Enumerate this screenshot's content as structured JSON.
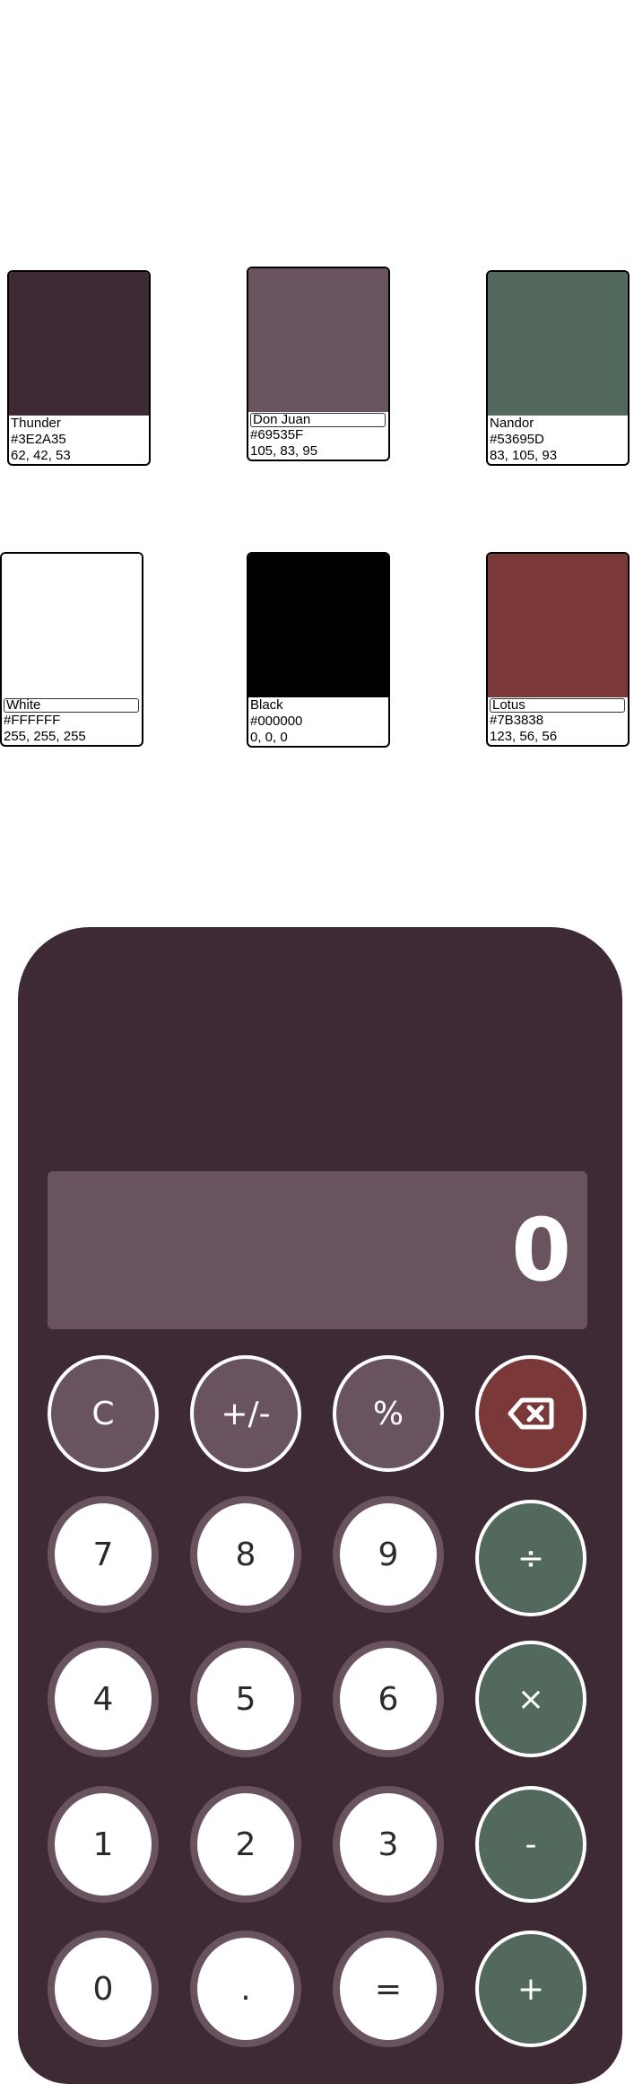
{
  "swatches": [
    {
      "name": "Thunder",
      "hex": "#3E2A35",
      "rgb": "62, 42, 53",
      "color": "#3E2A35"
    },
    {
      "name": "Don Juan",
      "hex": "#69535F",
      "rgb": "105, 83, 95",
      "color": "#69535F"
    },
    {
      "name": "Nandor",
      "hex": "#53695D",
      "rgb": "83, 105, 93",
      "color": "#53695D"
    },
    {
      "name": "White",
      "hex": "#FFFFFF",
      "rgb": "255, 255, 255",
      "color": "#FFFFFF"
    },
    {
      "name": "Black",
      "hex": "#000000",
      "rgb": "0, 0, 0",
      "color": "#000000"
    },
    {
      "name": "Lotus",
      "hex": "#7B3838",
      "rgb": "123, 56, 56",
      "color": "#7B3838"
    }
  ],
  "calculator": {
    "display": "0",
    "keys": {
      "clear": "C",
      "sign": "+/-",
      "percent": "%",
      "backspace_icon": "backspace-icon",
      "seven": "7",
      "eight": "8",
      "nine": "9",
      "divide": "÷",
      "four": "4",
      "five": "5",
      "six": "6",
      "multiply": "×",
      "one": "1",
      "two": "2",
      "three": "3",
      "minus": "-",
      "zero": "0",
      "decimal": ".",
      "equals": "=",
      "plus": "+"
    }
  }
}
